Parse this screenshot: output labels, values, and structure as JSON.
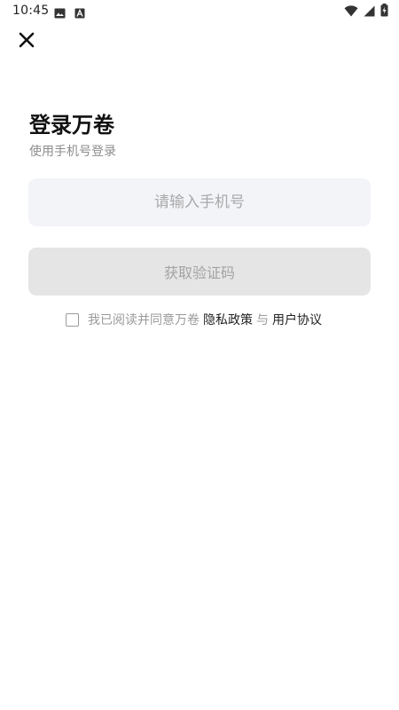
{
  "status_bar": {
    "time": "10:45",
    "left_icons": [
      "image-icon",
      "font-icon"
    ],
    "right_icons": [
      "wifi-icon",
      "signal-icon",
      "battery-charging-icon"
    ]
  },
  "header": {
    "close_icon": "close-icon"
  },
  "main": {
    "title": "登录万卷",
    "subtitle": "使用手机号登录",
    "phone_input": {
      "placeholder": "请输入手机号",
      "value": ""
    },
    "get_code_label": "获取验证码",
    "agreement": {
      "checked": false,
      "prefix": "我已阅读并同意万卷",
      "privacy_label": "隐私政策",
      "connector": "与",
      "terms_label": "用户协议"
    }
  },
  "colors": {
    "input_bg": "#f3f4f8",
    "button_bg": "#e5e5e5",
    "placeholder_text": "#a9a9a9",
    "muted_text": "#8d8d8d",
    "primary_text": "#111111"
  }
}
